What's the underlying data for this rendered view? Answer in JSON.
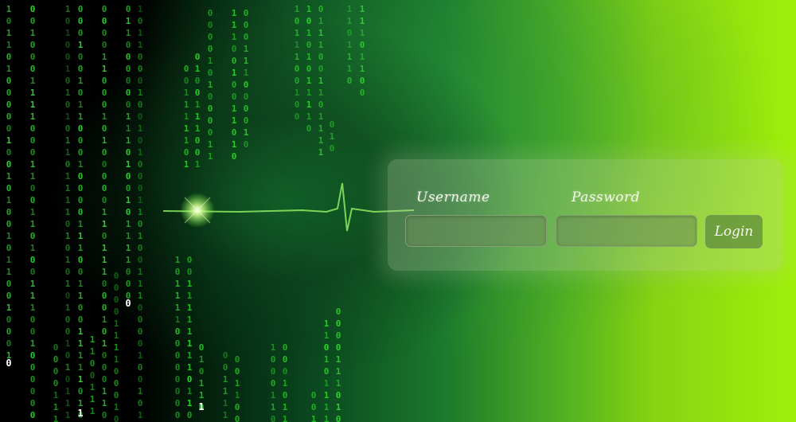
{
  "login": {
    "username_label": "Username",
    "username_value": "",
    "password_label": "Password",
    "password_value": "",
    "login_label": "Login"
  },
  "background": {
    "matrix_digits": [
      "0",
      "1"
    ],
    "matrix_color": "#2bd62b",
    "glow_color": "#e8ffd0",
    "left_color": "#000000",
    "right_color": "#9ff00a"
  }
}
